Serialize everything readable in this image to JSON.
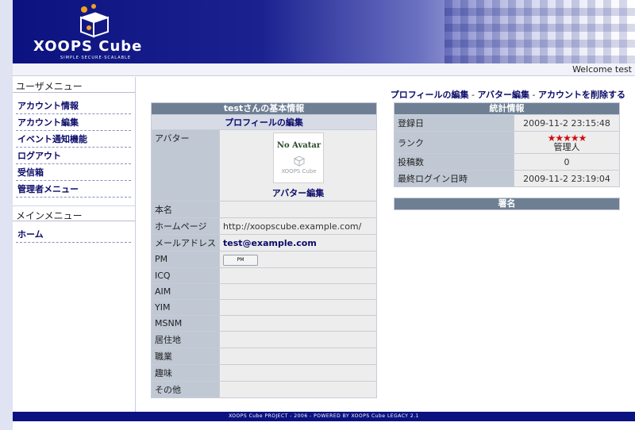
{
  "header": {
    "logo_text": "XOOPS Cube",
    "logo_tagline": "SIMPLE·SECURE·SCALABLE",
    "welcome": "Welcome test"
  },
  "sidebar": {
    "user_menu_title": "ユーザメニュー",
    "user_menu_items": [
      {
        "label": "アカウント情報"
      },
      {
        "label": "アカウント編集"
      },
      {
        "label": "イベント通知機能"
      },
      {
        "label": "ログアウト"
      },
      {
        "label": "受信箱"
      },
      {
        "label": "管理者メニュー"
      }
    ],
    "main_menu_title": "メインメニュー",
    "main_menu_items": [
      {
        "label": "ホーム"
      }
    ]
  },
  "content": {
    "links": {
      "edit_profile": "プロフィールの編集",
      "sep": " - ",
      "edit_avatar": "アバター編集",
      "delete_account": "アカウントを削除する"
    },
    "profile": {
      "title": "testさんの基本情報",
      "edit_profile": "プロフィールの編集",
      "avatar_label": "アバター",
      "no_avatar": "No Avatar",
      "avatar_brand": "XOOPS Cube",
      "avatar_edit": "アバター編集",
      "rows": [
        {
          "label": "本名",
          "value": ""
        },
        {
          "label": "ホームページ",
          "value": "http://xoopscube.example.com/"
        },
        {
          "label": "メールアドレス",
          "value": "test@example.com"
        },
        {
          "label": "PM",
          "value": ""
        },
        {
          "label": "ICQ",
          "value": ""
        },
        {
          "label": "AIM",
          "value": ""
        },
        {
          "label": "YIM",
          "value": ""
        },
        {
          "label": "MSNM",
          "value": ""
        },
        {
          "label": "居住地",
          "value": ""
        },
        {
          "label": "職業",
          "value": ""
        },
        {
          "label": "趣味",
          "value": ""
        },
        {
          "label": "その他",
          "value": ""
        }
      ],
      "pm_button": "PM"
    },
    "stats": {
      "title": "統計情報",
      "rows": [
        {
          "label": "登録日",
          "value": "2009-11-2 23:15:48"
        },
        {
          "label": "ランク",
          "value": "管理人",
          "stars": "★★★★★"
        },
        {
          "label": "投稿数",
          "value": "0"
        },
        {
          "label": "最終ログイン日時",
          "value": "2009-11-2 23:19:04"
        }
      ]
    },
    "signature": {
      "title": "署名"
    }
  },
  "footer": {
    "text": "XOOPS Cube PROJECT - 2006 - POWERED BY XOOPS Cube LEGACY 2.1"
  },
  "colors": {
    "header_dark": "#0c1280",
    "table_head": "#6e7f94",
    "label_bg": "#c0c8d4",
    "link": "#0a0a6a",
    "star": "#cc1010"
  }
}
